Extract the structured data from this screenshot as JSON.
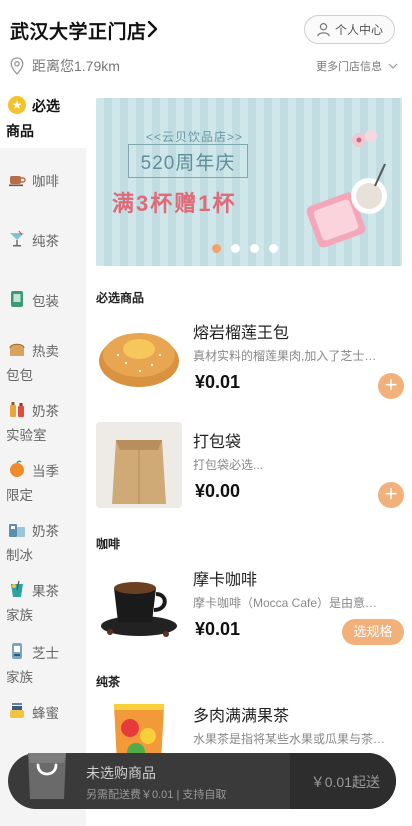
{
  "header": {
    "store_name": "武汉大学正门店",
    "personal_center": "个人中心",
    "distance": "距离您1.79km",
    "more_stores": "更多门店信息"
  },
  "sidebar": {
    "active": {
      "line1": "必选",
      "line2": "商品"
    },
    "items": [
      {
        "line1": "咖啡",
        "line2": "",
        "icon": "coffee-cup-icon"
      },
      {
        "line1": "纯茶",
        "line2": "",
        "icon": "cocktail-icon"
      },
      {
        "line1": "包装",
        "line2": "",
        "icon": "package-icon"
      },
      {
        "line1": "热卖",
        "line2": "包包",
        "icon": "bread-icon"
      },
      {
        "line1": "奶茶",
        "line2": "实验室",
        "icon": "bottles-icon"
      },
      {
        "line1": "当季",
        "line2": "限定",
        "icon": "orange-icon"
      },
      {
        "line1": "奶茶",
        "line2": "制冰",
        "icon": "ice-drink-icon"
      },
      {
        "line1": "果茶",
        "line2": "家族",
        "icon": "fruit-tea-icon"
      },
      {
        "line1": "芝士",
        "line2": "家族",
        "icon": "cheese-icon"
      },
      {
        "line1": "蜂蜜",
        "line2": "",
        "icon": "honey-icon"
      }
    ]
  },
  "banner": {
    "shop": "<<云贝饮品店>>",
    "anniversary": "520周年庆",
    "promo": "满3杯赠1杯",
    "slides": 4,
    "active_slide": 0
  },
  "sections": [
    {
      "title": "必选商品"
    },
    {
      "title": "咖啡"
    },
    {
      "title": "纯茶"
    }
  ],
  "products": [
    {
      "name": "熔岩榴莲王包",
      "desc": "真材实料的榴莲果肉,加入了芝士…",
      "price": "¥0.01",
      "action": "+"
    },
    {
      "name": "打包袋",
      "desc": "打包袋必选...",
      "price": "¥0.00",
      "action": "+"
    },
    {
      "name": "摩卡咖啡",
      "desc": "摩卡咖啡（Mocca Cafe）是由意…",
      "price": "¥0.01",
      "action": "选规格"
    },
    {
      "name": "多肉满满果茶",
      "desc": "水果茶是指将某些水果或瓜果与茶…",
      "price": "",
      "action": ""
    }
  ],
  "cart": {
    "empty_text": "未选购商品",
    "delivery_info": "另需配送费￥0.01 | 支持自取",
    "min_order": "￥0.01起送"
  },
  "colors": {
    "accent": "#f2b07a",
    "cart_bg": "#3a3a3a",
    "sidebar_bg": "#f4f4f4",
    "star": "#f4c22a"
  }
}
